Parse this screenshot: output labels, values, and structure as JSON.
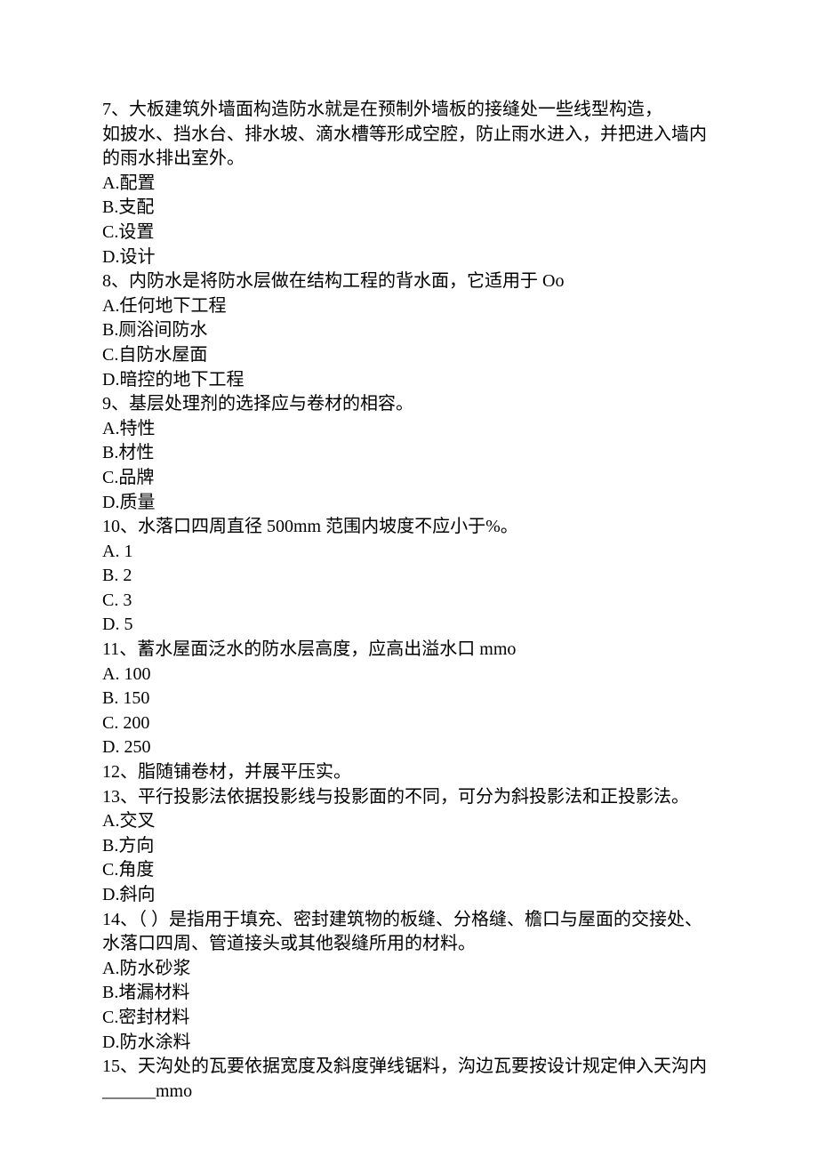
{
  "questions": [
    {
      "num": "7、",
      "text_lines": [
        "大板建筑外墙面构造防水就是在预制外墙板的接缝处一些线型构造，",
        "如披水、挡水台、排水坡、滴水槽等形成空腔，防止雨水进入，并把进入墙内",
        "的雨水排出室外。"
      ],
      "options": [
        "A.配置",
        "B.支配",
        "C.设置",
        "D.设计"
      ]
    },
    {
      "num": "8、",
      "text_lines": [
        "内防水是将防水层做在结构工程的背水面，它适用于 Oo"
      ],
      "options": [
        "A.任何地下工程",
        "B.厕浴间防水",
        "C.自防水屋面",
        "D.暗控的地下工程"
      ]
    },
    {
      "num": "9、",
      "text_lines": [
        "基层处理剂的选择应与卷材的相容。"
      ],
      "options": [
        "A.特性",
        "B.材性",
        "C.品牌",
        "D.质量"
      ]
    },
    {
      "num": "10、",
      "text_lines": [
        "水落口四周直径 500mm 范围内坡度不应小于%。"
      ],
      "options": [
        "A.   1",
        "B.   2",
        "C.   3",
        "D.   5"
      ]
    },
    {
      "num": "11、",
      "text_lines": [
        "蓄水屋面泛水的防水层高度，应高出溢水口 mmo"
      ],
      "options": [
        "A.   100",
        "B.   150",
        "C.   200",
        "D.   250"
      ]
    },
    {
      "num": "12、",
      "text_lines": [
        "脂随铺卷材，并展平压实。"
      ],
      "options": []
    },
    {
      "num": "13、",
      "text_lines": [
        "平行投影法依据投影线与投影面的不同，可分为斜投影法和正投影法。"
      ],
      "options": [
        "A.交叉",
        "B.方向",
        "C.角度",
        "D.斜向"
      ]
    },
    {
      "num": "14、",
      "text_lines": [
        "（ ）是指用于填充、密封建筑物的板缝、分格缝、檐口与屋面的交接处、",
        "水落口四周、管道接头或其他裂缝所用的材料。"
      ],
      "options": [
        "A.防水砂浆",
        "B.堵漏材料",
        "C.密封材料",
        "D.防水涂料"
      ]
    },
    {
      "num": "15、",
      "text_lines": [
        "天沟处的瓦要依据宽度及斜度弹线锯料，沟边瓦要按设计规定伸入天沟内",
        "______mmo"
      ],
      "options": []
    }
  ]
}
